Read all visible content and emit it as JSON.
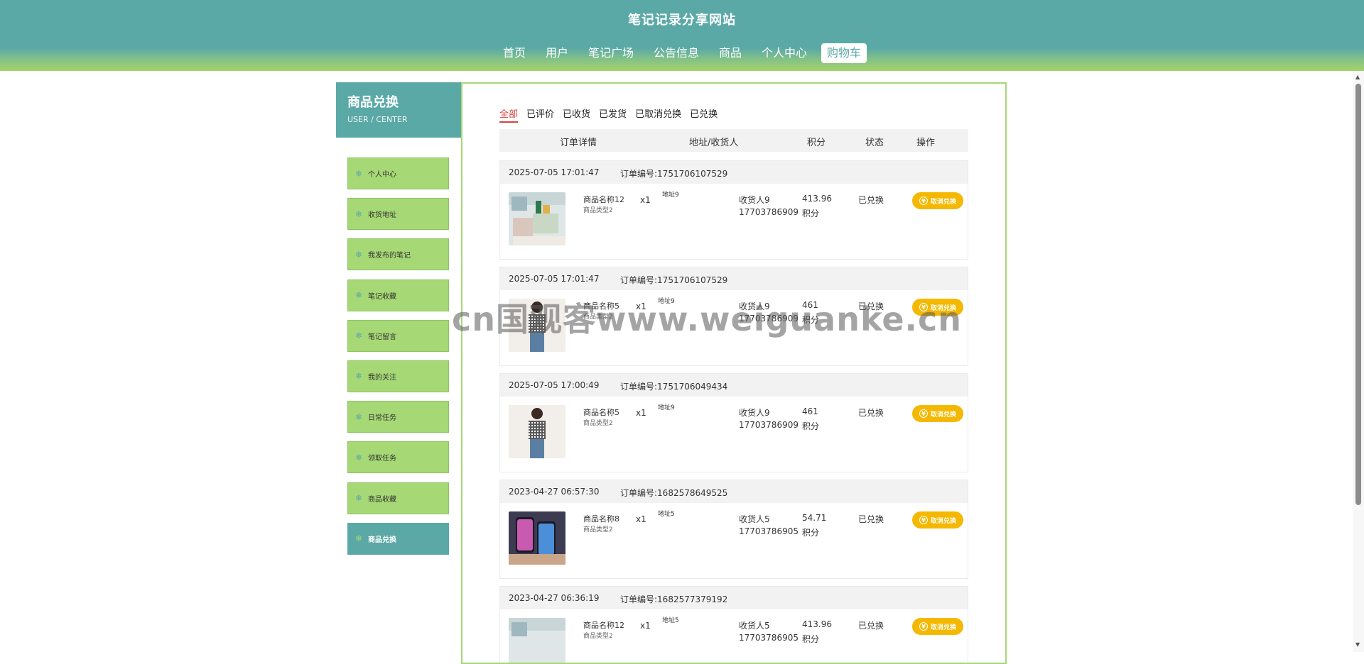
{
  "site": {
    "title": "笔记记录分享网站"
  },
  "nav": [
    "首页",
    "用户",
    "笔记广场",
    "公告信息",
    "商品",
    "个人中心",
    "购物车"
  ],
  "sidebar": {
    "title": "商品兑换",
    "subtitle": "USER / CENTER",
    "items": [
      "个人中心",
      "收货地址",
      "我发布的笔记",
      "笔记收藏",
      "笔记留言",
      "我的关注",
      "日常任务",
      "领取任务",
      "商品收藏",
      "商品兑换"
    ],
    "active_index": 9
  },
  "tabs": [
    "全部",
    "已评价",
    "已收货",
    "已发货",
    "已取消兑换",
    "已兑换"
  ],
  "table_headers": [
    "订单详情",
    "地址/收货人",
    "积分",
    "状态",
    "操作"
  ],
  "orders": [
    {
      "time": "2025-07-05 17:01:47",
      "order_no": "订单编号:1751706107529",
      "product": "商品名称12",
      "type": "商品类型2",
      "qty": "x1",
      "address": "地址9",
      "receiver": "收货人9",
      "phone": "17703786909",
      "points": "413.96",
      "points_unit": "积分",
      "status": "已兑换",
      "action": "取消兑换",
      "image": "desk-organizer"
    },
    {
      "time": "2025-07-05 17:01:47",
      "order_no": "订单编号:1751706107529",
      "product": "商品名称5",
      "type": "商品类型2",
      "qty": "x1",
      "address": "地址9",
      "receiver": "收货人9",
      "phone": "17703786909",
      "points": "461",
      "points_unit": "积分",
      "status": "已兑换",
      "action": "取消兑换",
      "image": "fashion-model"
    },
    {
      "time": "2025-07-05 17:00:49",
      "order_no": "订单编号:1751706049434",
      "product": "商品名称5",
      "type": "商品类型2",
      "qty": "x1",
      "address": "地址9",
      "receiver": "收货人9",
      "phone": "17703786909",
      "points": "461",
      "points_unit": "积分",
      "status": "已兑换",
      "action": "取消兑换",
      "image": "fashion-model"
    },
    {
      "time": "2023-04-27 06:57:30",
      "order_no": "订单编号:1682578649525",
      "product": "商品名称8",
      "type": "商品类型2",
      "qty": "x1",
      "address": "地址5",
      "receiver": "收货人5",
      "phone": "17703786905",
      "points": "54.71",
      "points_unit": "积分",
      "status": "已兑换",
      "action": "取消兑换",
      "image": "smartphones"
    },
    {
      "time": "2023-04-27 06:36:19",
      "order_no": "订单编号:1682577379192",
      "product": "商品名称12",
      "type": "商品类型2",
      "qty": "x1",
      "address": "地址5",
      "receiver": "收货人5",
      "phone": "17703786905",
      "points": "413.96",
      "points_unit": "积分",
      "status": "已兑换",
      "action": "取消兑换",
      "image": "desk-organizer"
    }
  ],
  "watermark": "cn国观客www.weiguanke.cn",
  "colors": {
    "primary": "#5ba9a7",
    "accent_green": "#a6d875",
    "button_yellow": "#f5b800",
    "tab_active": "#d9423b"
  }
}
